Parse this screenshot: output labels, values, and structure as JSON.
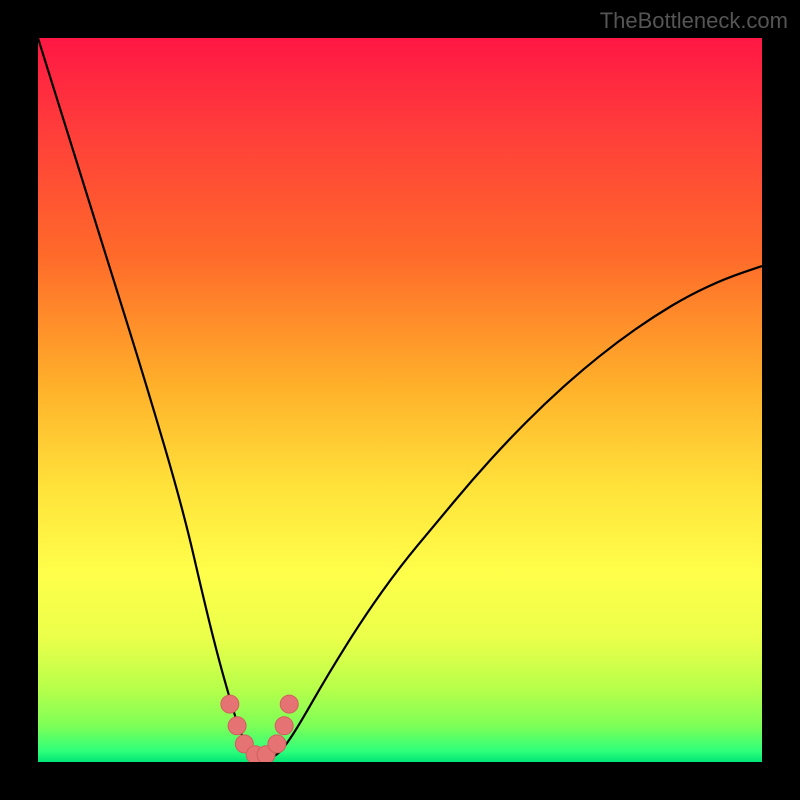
{
  "watermark": "TheBottleneck.com",
  "colors": {
    "frame": "#000000",
    "curve": "#000000",
    "marker_fill": "#e57373",
    "marker_stroke": "#d25f5f",
    "gradient_stops": [
      {
        "offset": 0.0,
        "color": "#ff1744"
      },
      {
        "offset": 0.12,
        "color": "#ff3b3b"
      },
      {
        "offset": 0.3,
        "color": "#ff6a2a"
      },
      {
        "offset": 0.48,
        "color": "#ffb02a"
      },
      {
        "offset": 0.62,
        "color": "#ffe23a"
      },
      {
        "offset": 0.74,
        "color": "#ffff4a"
      },
      {
        "offset": 0.83,
        "color": "#eaff4a"
      },
      {
        "offset": 0.9,
        "color": "#b6ff4a"
      },
      {
        "offset": 0.95,
        "color": "#7dff57"
      },
      {
        "offset": 0.985,
        "color": "#2fff7a"
      },
      {
        "offset": 1.0,
        "color": "#00e676"
      }
    ]
  },
  "chart_data": {
    "type": "line",
    "title": "",
    "xlabel": "",
    "ylabel": "",
    "xlim": [
      0,
      100
    ],
    "ylim": [
      0,
      100
    ],
    "series": [
      {
        "name": "bottleneck-curve",
        "x": [
          0,
          5,
          10,
          15,
          20,
          23,
          25,
          27,
          28,
          29,
          30,
          31,
          32,
          33,
          34,
          36,
          40,
          45,
          50,
          55,
          60,
          65,
          70,
          75,
          80,
          85,
          90,
          95,
          100
        ],
        "y": [
          100,
          84,
          68,
          52,
          35,
          22,
          14,
          7,
          4,
          2,
          1,
          0.5,
          0.5,
          1,
          2,
          5,
          12,
          20,
          27,
          33,
          39,
          44.5,
          49.5,
          54,
          58,
          61.5,
          64.5,
          66.8,
          68.5
        ]
      }
    ],
    "markers": {
      "name": "highlight-points",
      "x": [
        26.5,
        27.5,
        28.5,
        30,
        31.5,
        33,
        34,
        34.7
      ],
      "y": [
        8,
        5,
        2.5,
        1,
        1,
        2.5,
        5,
        8
      ]
    }
  }
}
